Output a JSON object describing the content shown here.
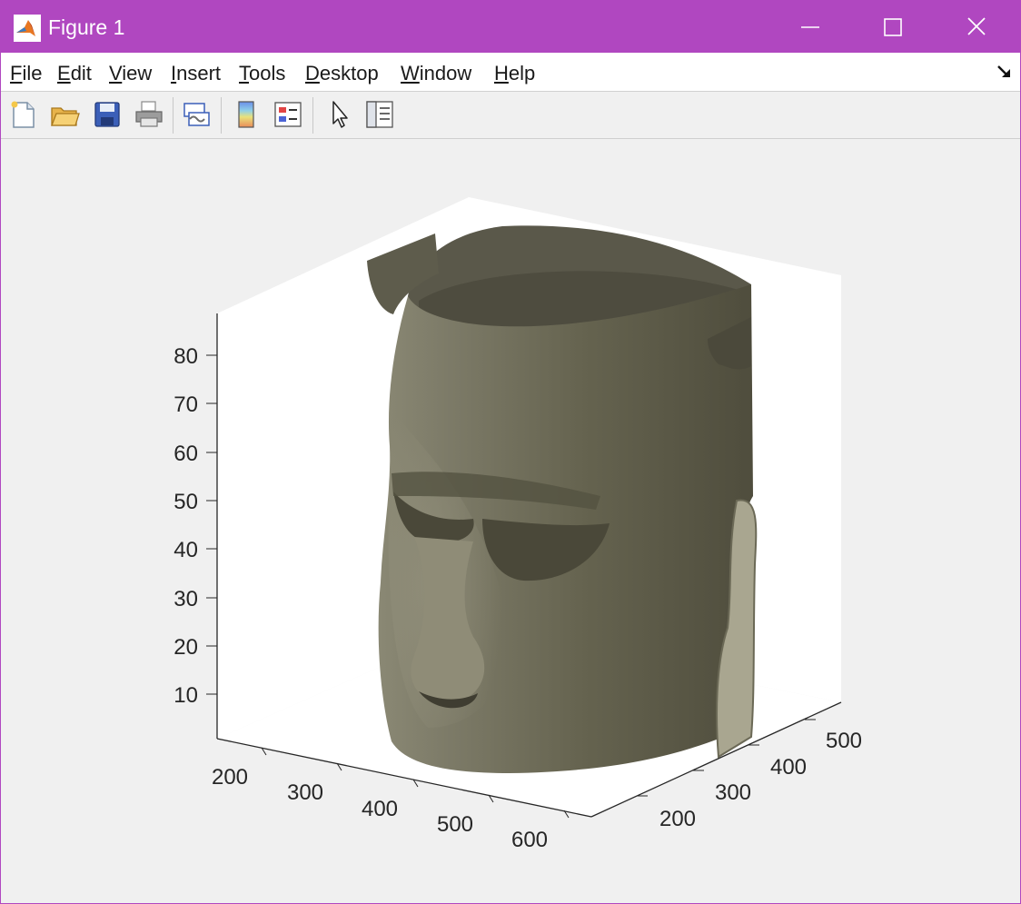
{
  "window": {
    "title": "Figure 1"
  },
  "menu": [
    "File",
    "Edit",
    "View",
    "Insert",
    "Tools",
    "Desktop",
    "Window",
    "Help"
  ],
  "menu_mnemonic": [
    "F",
    "E",
    "V",
    "I",
    "T",
    "D",
    "W",
    "H"
  ],
  "toolbar_icons": [
    "new-figure-icon",
    "open-file-icon",
    "save-icon",
    "print-icon",
    "link-plot-icon",
    "colorbar-icon",
    "legend-icon",
    "edit-plot-cursor-icon",
    "property-inspector-icon"
  ],
  "axes": {
    "z_ticks": [
      "10",
      "20",
      "30",
      "40",
      "50",
      "60",
      "70",
      "80"
    ],
    "x_ticks": [
      "200",
      "300",
      "400",
      "500",
      "600"
    ],
    "y_ticks": [
      "200",
      "300",
      "400",
      "500"
    ]
  },
  "colors": {
    "titlebar": "#b047c0",
    "surface": "#6f6d5c"
  }
}
